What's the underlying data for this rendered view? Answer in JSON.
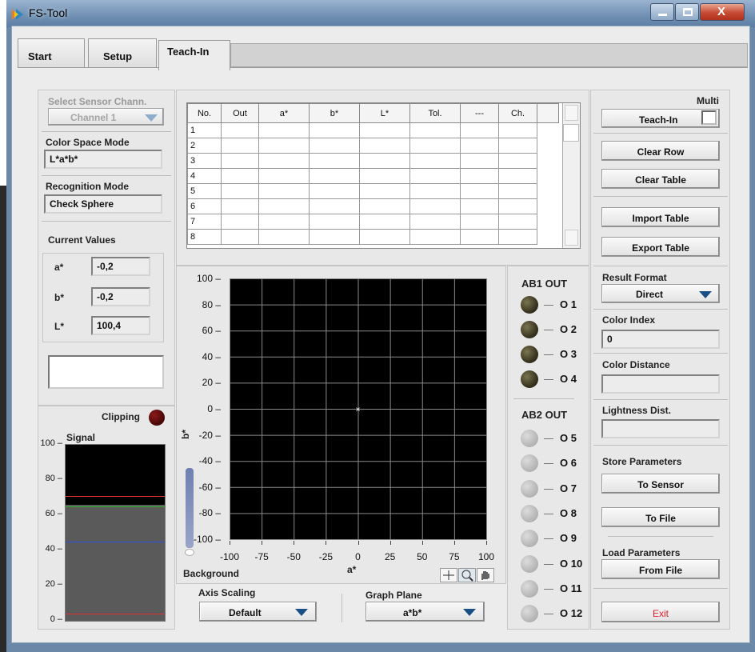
{
  "window": {
    "title": "FS-Tool"
  },
  "tabs": [
    {
      "label": "Start"
    },
    {
      "label": "Setup"
    },
    {
      "label": "Teach-In"
    }
  ],
  "left": {
    "sensor_channel": {
      "label": "Select Sensor Chann.",
      "value": "Channel 1"
    },
    "color_space": {
      "label": "Color Space Mode",
      "value": "L*a*b*"
    },
    "recognition": {
      "label": "Recognition Mode",
      "value": "Check Sphere"
    },
    "current": {
      "label": "Current Values",
      "rows": [
        {
          "name": "a*",
          "value": "-0,2"
        },
        {
          "name": "b*",
          "value": "-0,2"
        },
        {
          "name": "L*",
          "value": "100,4"
        }
      ]
    },
    "clipping_label": "Clipping",
    "signal": {
      "label": "Signal",
      "ticks": [
        "100",
        "80",
        "60",
        "40",
        "20",
        "0"
      ],
      "fill_level": 0.66,
      "red_lines": [
        0.71,
        0.04
      ],
      "green_line": 0.65,
      "blue_line": 0.45
    }
  },
  "table": {
    "headers": [
      "No.",
      "Out",
      "a*",
      "b*",
      "L*",
      "Tol.",
      "---",
      "Ch.",
      ""
    ],
    "rows": [
      "1",
      "2",
      "3",
      "4",
      "5",
      "6",
      "7",
      "8"
    ]
  },
  "plot": {
    "ylabel": "b*",
    "xlabel": "a*",
    "yticks": [
      "100",
      "80",
      "60",
      "40",
      "20",
      "0",
      "-20",
      "-40",
      "-60",
      "-80",
      "-100"
    ],
    "xticks": [
      "-100",
      "-75",
      "-50",
      "-25",
      "0",
      "25",
      "50",
      "75",
      "100"
    ],
    "background_label": "Background",
    "axis_scaling": {
      "label": "Axis Scaling",
      "value": "Default"
    },
    "graph_plane": {
      "label": "Graph Plane",
      "value": "a*b*"
    },
    "point": {
      "a": 0,
      "b": 0
    }
  },
  "outputs": {
    "ab1_label": "AB1 OUT",
    "ab2_label": "AB2 OUT",
    "ab1": [
      "O 1",
      "O 2",
      "O 3",
      "O 4"
    ],
    "ab2": [
      "O 5",
      "O 6",
      "O 7",
      "O 8",
      "O 9",
      "O 10",
      "O 11",
      "O 12"
    ]
  },
  "right": {
    "multi_label": "Multi",
    "teach_in": "Teach-In",
    "clear_row": "Clear Row",
    "clear_table": "Clear Table",
    "import_table": "Import Table",
    "export_table": "Export Table",
    "result_format": {
      "label": "Result Format",
      "value": "Direct"
    },
    "color_index": {
      "label": "Color Index",
      "value": "0"
    },
    "color_distance": {
      "label": "Color Distance",
      "value": ""
    },
    "lightness_dist": {
      "label": "Lightness Dist.",
      "value": ""
    },
    "store_params": "Store Parameters",
    "to_sensor": "To Sensor",
    "to_file": "To File",
    "load_params": "Load Parameters",
    "from_file": "From File",
    "exit": "Exit",
    "exit_color": "#d8232a"
  }
}
